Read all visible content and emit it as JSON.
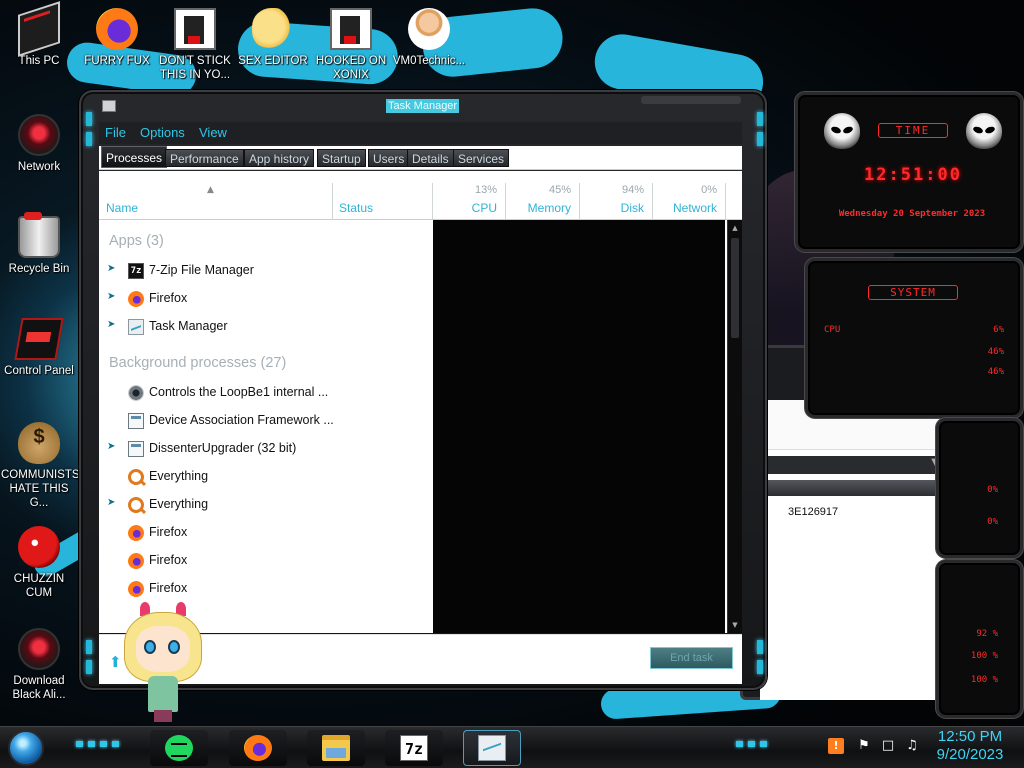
{
  "desktop": {
    "icons": [
      {
        "label": "This PC"
      },
      {
        "label": "FURRY FUX"
      },
      {
        "label": "DON'T STICK THIS IN YO..."
      },
      {
        "label": "SEX EDITOR"
      },
      {
        "label": "HOOKED ON XONIX"
      },
      {
        "label": "VM0Technic..."
      },
      {
        "label": "Network"
      },
      {
        "label": "Recycle Bin"
      },
      {
        "label": "Control Panel"
      },
      {
        "label": "COMMUNISTS HATE THIS G..."
      },
      {
        "label": "CHUZZIN CUM"
      },
      {
        "label": "Download Black Ali..."
      }
    ]
  },
  "widgets": {
    "time_title": "TIME",
    "clock": "12:51:00",
    "date": "Wednesday 20 September 2023",
    "system_title": "SYSTEM",
    "cpu_label": "CPU",
    "cpu_value": "6%",
    "mem_value": "46%",
    "mem2_value": "46%",
    "net_up": "0%",
    "net_down": "0%",
    "disk1": "92 %",
    "disk2": "100 %",
    "disk3": "100 %",
    "accent_color": "#ff2a2a"
  },
  "background_window": {
    "value": "3E126917"
  },
  "task_manager": {
    "title": "Task Manager",
    "menu": [
      "File",
      "Options",
      "View"
    ],
    "tabs": [
      "Processes",
      "Performance",
      "App history",
      "Startup",
      "Users",
      "Details",
      "Services"
    ],
    "active_tab": "Processes",
    "columns": {
      "name": "Name",
      "status": "Status",
      "cpu": {
        "label": "CPU",
        "percent": "13%"
      },
      "memory": {
        "label": "Memory",
        "percent": "45%"
      },
      "disk": {
        "label": "Disk",
        "percent": "94%"
      },
      "network": {
        "label": "Network",
        "percent": "0%"
      }
    },
    "groups": {
      "apps": "Apps (3)",
      "background": "Background processes (27)"
    },
    "apps": [
      {
        "name": "7-Zip File Manager",
        "icon": "7zip-icon"
      },
      {
        "name": "Firefox",
        "icon": "firefox-icon"
      },
      {
        "name": "Task Manager",
        "icon": "task-manager-icon"
      }
    ],
    "background_processes": [
      {
        "name": "Controls the LoopBe1 internal ...",
        "icon": "loopbe-icon"
      },
      {
        "name": "Device Association Framework ...",
        "icon": "app-window-icon"
      },
      {
        "name": "DissenterUpgrader (32 bit)",
        "icon": "app-window-icon"
      },
      {
        "name": "Everything",
        "icon": "everything-search-icon"
      },
      {
        "name": "Everything",
        "icon": "everything-search-icon"
      },
      {
        "name": "Firefox",
        "icon": "firefox-icon"
      },
      {
        "name": "Firefox",
        "icon": "firefox-icon"
      },
      {
        "name": "Firefox",
        "icon": "firefox-icon"
      }
    ],
    "end_task": "End task"
  },
  "taskbar": {
    "time": "12:50 PM",
    "date": "9/20/2023",
    "accent_color": "#31c6e7"
  }
}
